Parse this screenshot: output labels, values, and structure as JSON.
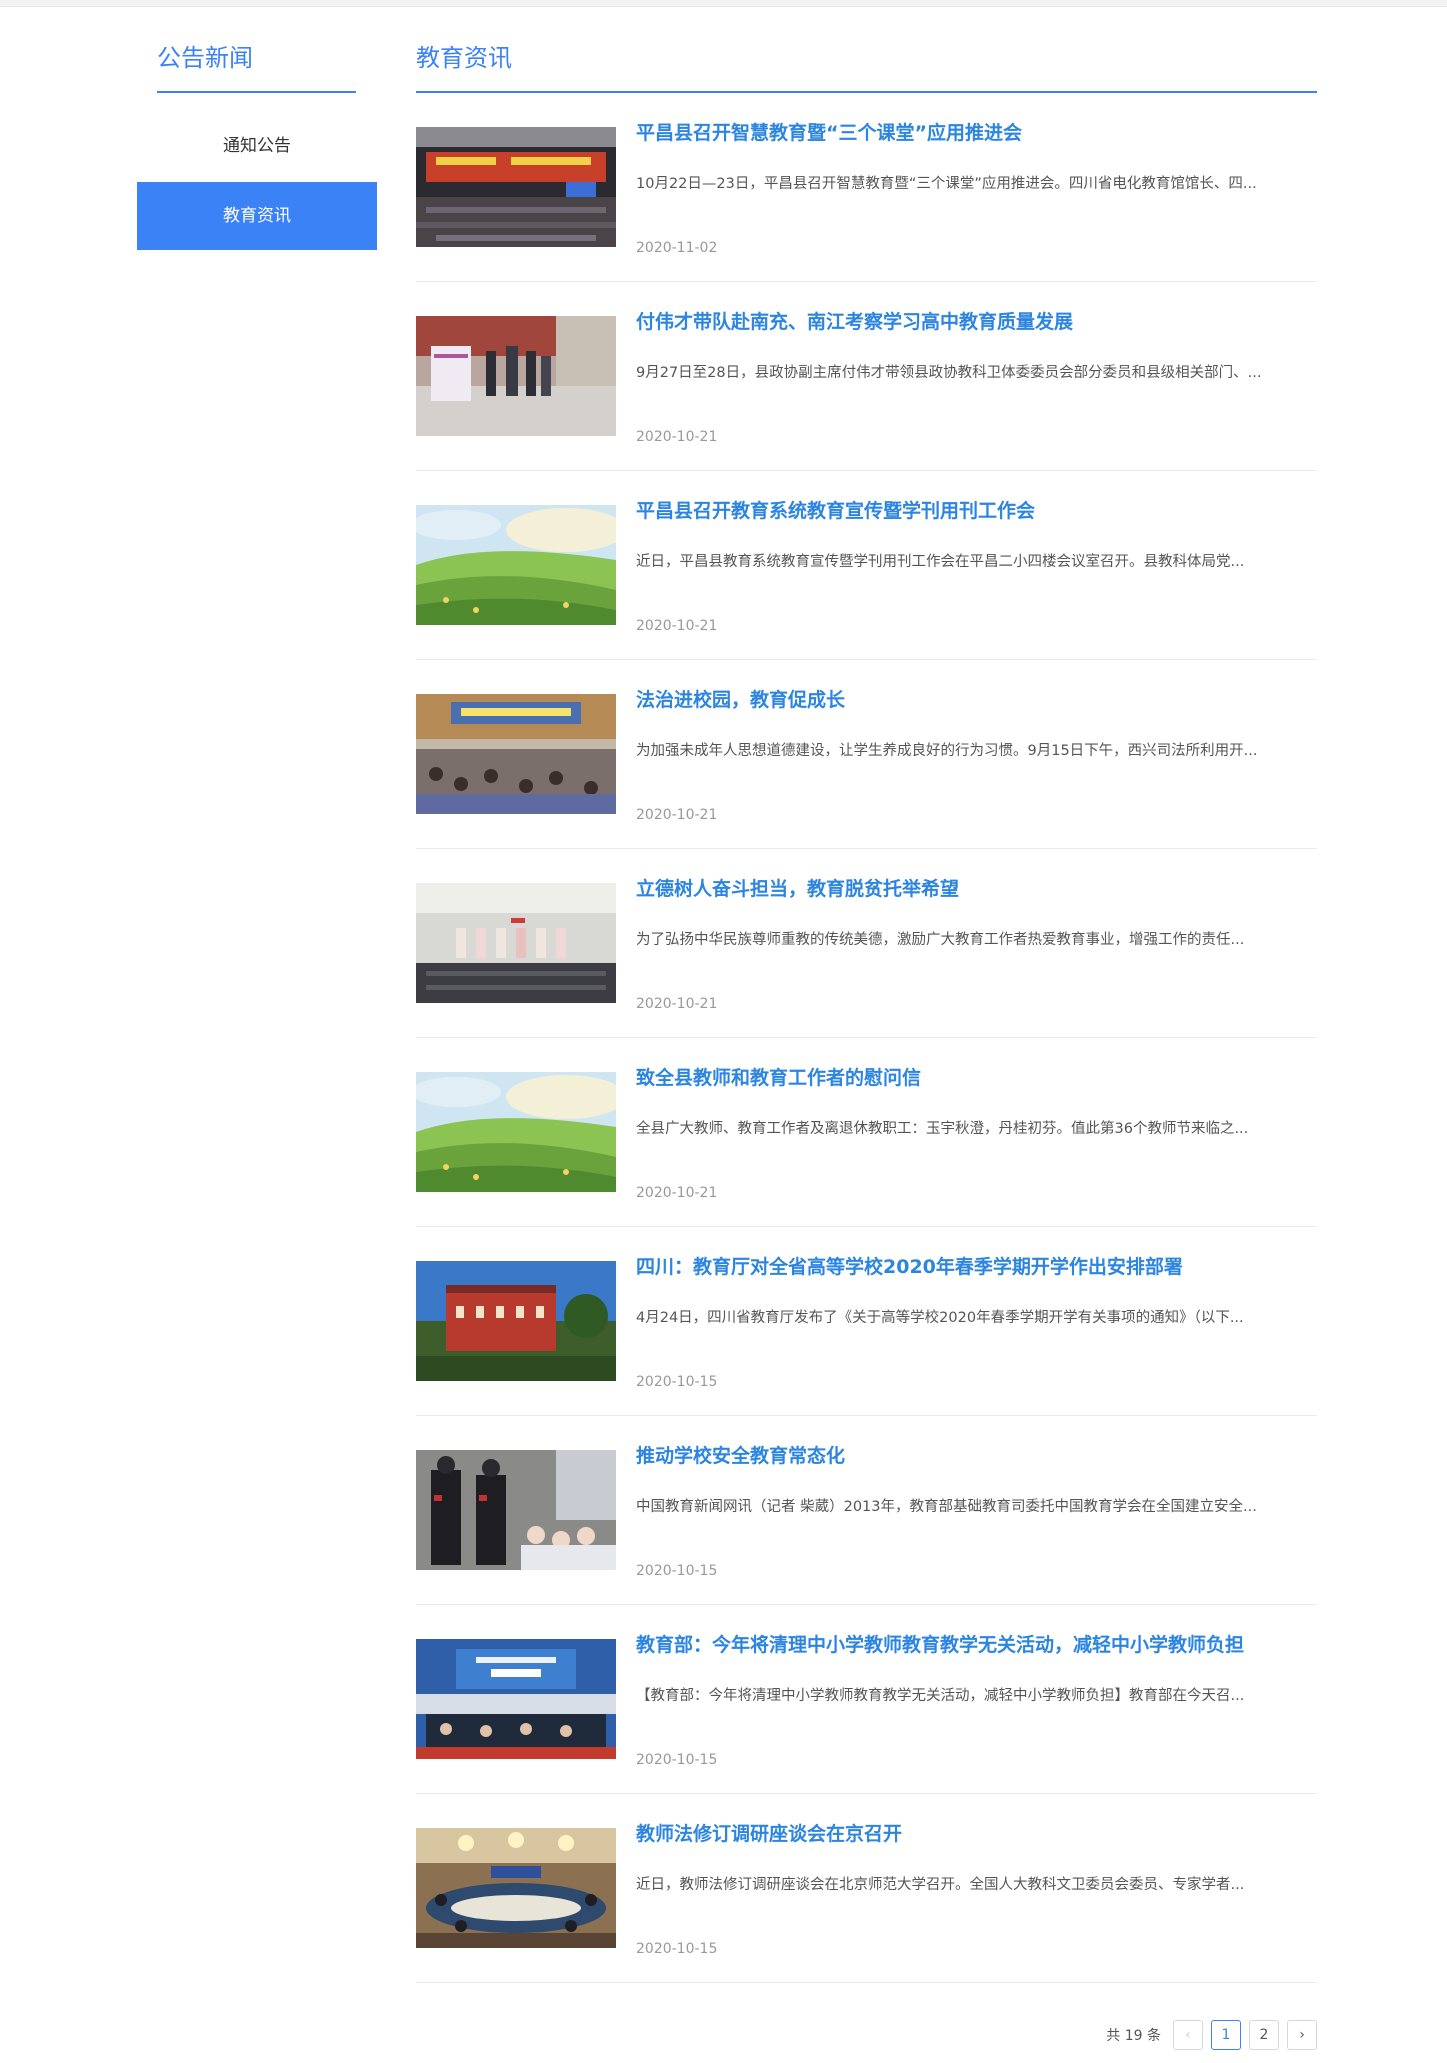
{
  "sidebar": {
    "title": "公告新闻",
    "items": [
      {
        "label": "通知公告",
        "active": false
      },
      {
        "label": "教育资讯",
        "active": true
      }
    ]
  },
  "main": {
    "title": "教育资讯",
    "articles": [
      {
        "title": "平昌县召开智慧教育暨“三个课堂”应用推进会",
        "summary": "10月22日—23日，平昌县召开智慧教育暨“三个课堂”应用推进会。四川省电化教育馆馆长、四...",
        "date": "2020-11-02",
        "image": "conference-hall-photo"
      },
      {
        "title": "付伟才带队赴南充、南江考察学习高中教育质量发展",
        "summary": "9月27日至28日，县政协副主席付伟才带领县政协教科卫体委委员会部分委员和县级相关部门、...",
        "date": "2020-10-21",
        "image": "school-visit-photo"
      },
      {
        "title": "平昌县召开教育系统教育宣传暨学刊用刊工作会",
        "summary": "近日，平昌县教育系统教育宣传暨学刊用刊工作会在平昌二小四楼会议室召开。县教科体局党...",
        "date": "2020-10-21",
        "image": "meadow-illustration"
      },
      {
        "title": "法治进校园，教育促成长",
        "summary": "为加强未成年人思想道德建设，让学生养成良好的行为习惯。9月15日下午，西兴司法所利用开...",
        "date": "2020-10-21",
        "image": "school-assembly-photo"
      },
      {
        "title": "立德树人奋斗担当，教育脱贫托举希望",
        "summary": "为了弘扬中华民族尊师重教的传统美德，激励广大教育工作者热爱教育事业，增强工作的责任...",
        "date": "2020-10-21",
        "image": "award-ceremony-photo"
      },
      {
        "title": "致全县教师和教育工作者的慰问信",
        "summary": "全县广大教师、教育工作者及离退休教职工：玉宇秋澄，丹桂初芬。值此第36个教师节来临之...",
        "date": "2020-10-21",
        "image": "meadow-illustration"
      },
      {
        "title": "四川：教育厅对全省高等学校2020年春季学期开学作出安排部署",
        "summary": "4月24日，四川省教育厅发布了《关于高等学校2020年春季学期开学有关事项的通知》（以下...",
        "date": "2020-10-15",
        "image": "university-building-photo"
      },
      {
        "title": "推动学校安全教育常态化",
        "summary": "中国教育新闻网讯（记者 柴葳）2013年，教育部基础教育司委托中国教育学会在全国建立安全...",
        "date": "2020-10-15",
        "image": "security-guards-photo"
      },
      {
        "title": "教育部：今年将清理中小学教师教育教学无关活动，减轻中小学教师负担",
        "summary": "【教育部：今年将清理中小学教师教育教学无关活动，减轻中小学教师负担】教育部在今天召...",
        "date": "2020-10-15",
        "image": "press-conference-photo"
      },
      {
        "title": "教师法修订调研座谈会在京召开",
        "summary": "近日，教师法修订调研座谈会在北京师范大学召开。全国人大教科文卫委员会委员、专家学者...",
        "date": "2020-10-15",
        "image": "meeting-room-photo"
      }
    ]
  },
  "pagination": {
    "total_text": "共 19 条",
    "prev_icon": "‹",
    "next_icon": "›",
    "pages": [
      "1",
      "2"
    ],
    "current": "1"
  },
  "colors": {
    "accent": "#3b82f6",
    "title_link": "#2c85e0",
    "date": "#999999"
  }
}
